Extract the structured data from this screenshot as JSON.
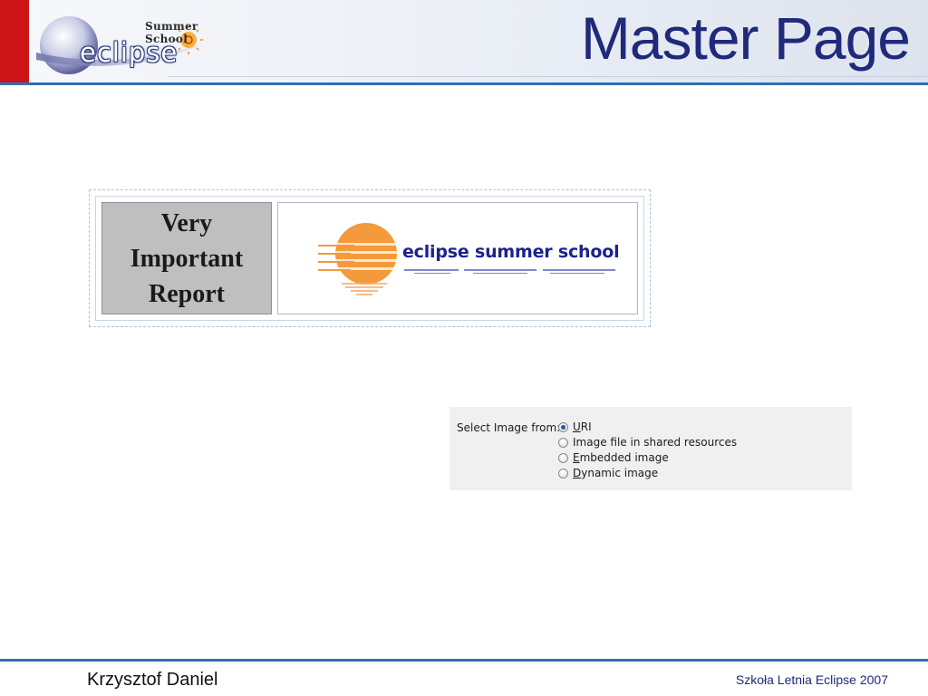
{
  "header": {
    "title": "Master Page",
    "logo": {
      "word": "eclipse",
      "tagline": "Summer School"
    }
  },
  "report_preview": {
    "label": "Very\nImportant\nReport",
    "brand_text": "eclipse summer school"
  },
  "image_source_dialog": {
    "label": "Select Image from:",
    "options": [
      {
        "pre": "",
        "mnemonic": "U",
        "post": "RI",
        "checked": true
      },
      {
        "pre": "Image file in shared resources",
        "mnemonic": "",
        "post": "",
        "checked": false
      },
      {
        "pre": "",
        "mnemonic": "E",
        "post": "mbedded image",
        "checked": false
      },
      {
        "pre": "",
        "mnemonic": "D",
        "post": "ynamic image",
        "checked": false
      }
    ]
  },
  "footer": {
    "author": "Krzysztof Daniel",
    "event": "Szkoła Letnia Eclipse 2007"
  },
  "colors": {
    "accent_blue": "#2e6fb5",
    "title_navy": "#1f2a7a",
    "brand_red": "#cc1417",
    "sun_orange": "#f39a3c"
  }
}
